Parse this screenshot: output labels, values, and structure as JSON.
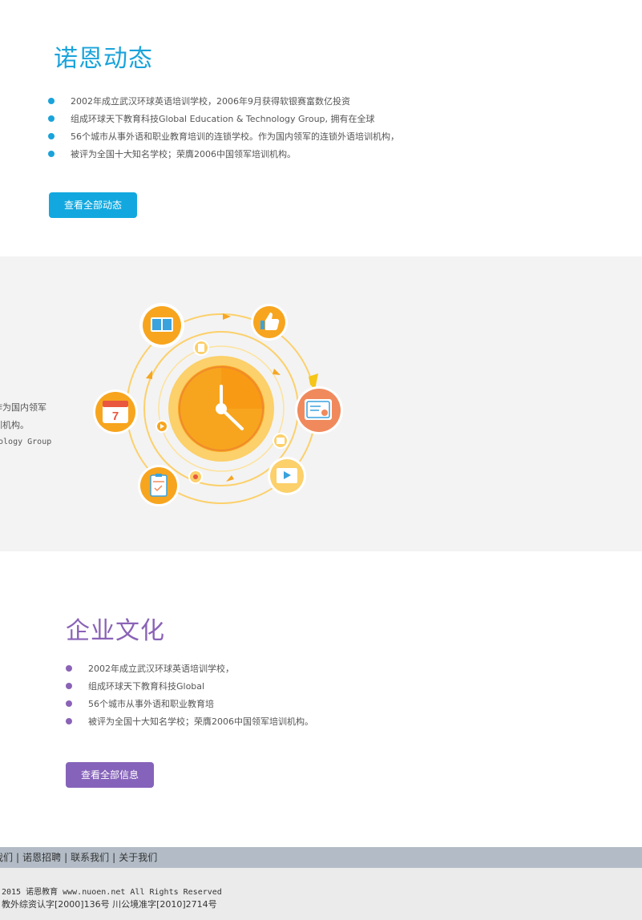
{
  "news": {
    "title": "诺恩动态",
    "items": [
      "2002年成立武汉环球英语培训学校，2006年9月获得软银赛富数亿投资",
      "组成环球天下教育科技Global Education & Technology Group, 拥有在全球",
      "56个城市从事外语和职业教育培训的连锁学校。作为国内领军的连锁外语培训机构，",
      "被评为全国十大知名学校；荣膺2006中国领军培训机构。"
    ],
    "button": "查看全部动态"
  },
  "feature": {
    "cut_lines": [
      "作为国内领军",
      "训机构。",
      "nology Group"
    ],
    "icons": [
      "book-icon",
      "thumbs-up-icon",
      "certificate-icon",
      "video-play-icon",
      "clipboard-icon",
      "calendar-icon",
      "clock-icon"
    ],
    "calendar_day": "7",
    "colors": {
      "orange": "#f7a51e",
      "light_orange": "#fcd06a",
      "coral": "#f08a5d"
    }
  },
  "culture": {
    "title": "企业文化",
    "items": [
      "2002年成立武汉环球英语培训学校，",
      "组成环球天下教育科技Global",
      "56个城市从事外语和职业教育培",
      "被评为全国十大知名学校；荣膺2006中国领军培训机构。"
    ],
    "button": "查看全部信息"
  },
  "footer": {
    "links": [
      "我们",
      "诺恩招聘",
      "联系我们",
      "关于我们"
    ],
    "copyright": "2015 诺恩教育 www.nuoen.net All Rights Reserved",
    "license": "教外综资认字[2000]136号 川公境准字[2010]2714号"
  },
  "accent": {
    "blue": "#12a8df",
    "purple": "#8663ba"
  }
}
